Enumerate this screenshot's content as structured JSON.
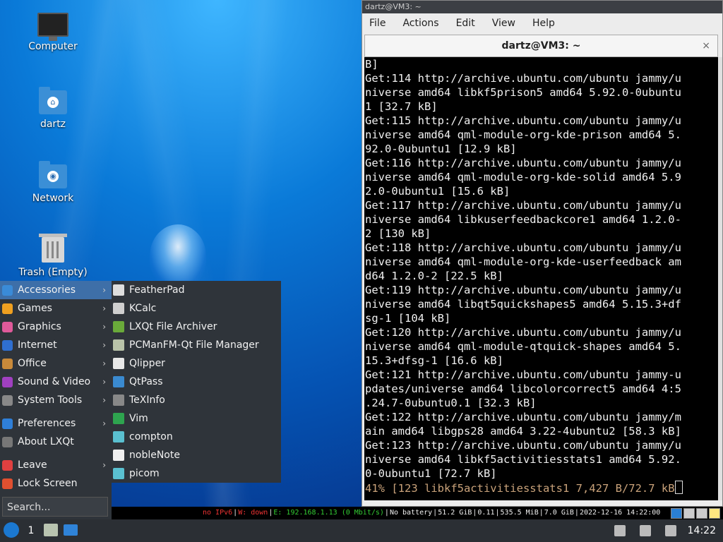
{
  "desktop": {
    "icons": [
      {
        "label": "Computer",
        "icon": "computer-icon"
      },
      {
        "label": "dartz",
        "icon": "home-folder-icon"
      },
      {
        "label": "Network",
        "icon": "network-folder-icon"
      },
      {
        "label": "Trash (Empty)",
        "icon": "trash-icon"
      }
    ]
  },
  "terminal": {
    "window_title": "dartz@VM3: ~",
    "menu": [
      "File",
      "Actions",
      "Edit",
      "View",
      "Help"
    ],
    "tab_title": "dartz@VM3: ~",
    "close_glyph": "×",
    "lines": [
      "B]",
      "Get:114 http://archive.ubuntu.com/ubuntu jammy/u",
      "niverse amd64 libkf5prison5 amd64 5.92.0-0ubuntu",
      "1 [32.7 kB]",
      "Get:115 http://archive.ubuntu.com/ubuntu jammy/u",
      "niverse amd64 qml-module-org-kde-prison amd64 5.",
      "92.0-0ubuntu1 [12.9 kB]",
      "Get:116 http://archive.ubuntu.com/ubuntu jammy/u",
      "niverse amd64 qml-module-org-kde-solid amd64 5.9",
      "2.0-0ubuntu1 [15.6 kB]",
      "Get:117 http://archive.ubuntu.com/ubuntu jammy/u",
      "niverse amd64 libkuserfeedbackcore1 amd64 1.2.0-",
      "2 [130 kB]",
      "Get:118 http://archive.ubuntu.com/ubuntu jammy/u",
      "niverse amd64 qml-module-org-kde-userfeedback am",
      "d64 1.2.0-2 [22.5 kB]",
      "Get:119 http://archive.ubuntu.com/ubuntu jammy/u",
      "niverse amd64 libqt5quickshapes5 amd64 5.15.3+df",
      "sg-1 [104 kB]",
      "Get:120 http://archive.ubuntu.com/ubuntu jammy/u",
      "niverse amd64 qml-module-qtquick-shapes amd64 5.",
      "15.3+dfsg-1 [16.6 kB]",
      "Get:121 http://archive.ubuntu.com/ubuntu jammy-u",
      "pdates/universe amd64 libcolorcorrect5 amd64 4:5",
      ".24.7-0ubuntu0.1 [32.3 kB]",
      "Get:122 http://archive.ubuntu.com/ubuntu jammy/m",
      "ain amd64 libgps28 amd64 3.22-4ubuntu2 [58.3 kB]",
      "Get:123 http://archive.ubuntu.com/ubuntu jammy/u",
      "niverse amd64 libkf5activitiesstats1 amd64 5.92.",
      "0-0ubuntu1 [72.7 kB]"
    ],
    "progress_line": "41% [123 libkf5activitiesstats1 7,427 B/72.7 kB"
  },
  "start_menu": {
    "categories": [
      {
        "label": "Accessories",
        "icon": "accessories-icon",
        "submenu": true,
        "active": true,
        "color": "#3a8bd8"
      },
      {
        "label": "Games",
        "icon": "games-icon",
        "submenu": true,
        "color": "#f0a020"
      },
      {
        "label": "Graphics",
        "icon": "graphics-icon",
        "submenu": true,
        "color": "#e05a9a"
      },
      {
        "label": "Internet",
        "icon": "internet-icon",
        "submenu": true,
        "color": "#2f6fd0"
      },
      {
        "label": "Office",
        "icon": "office-icon",
        "submenu": true,
        "color": "#c98a3a"
      },
      {
        "label": "Sound & Video",
        "icon": "sound-video-icon",
        "submenu": true,
        "color": "#a040c0"
      },
      {
        "label": "System Tools",
        "icon": "system-tools-icon",
        "submenu": true,
        "color": "#888888"
      }
    ],
    "settings": [
      {
        "label": "Preferences",
        "icon": "preferences-icon",
        "submenu": true,
        "color": "#2f7fd8"
      },
      {
        "label": "About LXQt",
        "icon": "about-icon",
        "submenu": false,
        "color": "#777777"
      }
    ],
    "session": [
      {
        "label": "Leave",
        "icon": "leave-icon",
        "submenu": true,
        "color": "#e04040"
      },
      {
        "label": "Lock Screen",
        "icon": "lock-icon",
        "submenu": false,
        "color": "#e05030"
      }
    ],
    "search_placeholder": "Search...",
    "arrow_glyph": "›"
  },
  "accessories_submenu": [
    {
      "label": "FeatherPad",
      "icon": "featherpad-icon",
      "color": "#dddddd"
    },
    {
      "label": "KCalc",
      "icon": "kcalc-icon",
      "color": "#cfcfcf"
    },
    {
      "label": "LXQt File Archiver",
      "icon": "archiver-icon",
      "color": "#6aaa3a"
    },
    {
      "label": "PCManFM-Qt File Manager",
      "icon": "file-manager-icon",
      "color": "#b8c2a8"
    },
    {
      "label": "Qlipper",
      "icon": "clipboard-icon",
      "color": "#e8e8e8"
    },
    {
      "label": "QtPass",
      "icon": "qtpass-icon",
      "color": "#3a8ad0"
    },
    {
      "label": "TeXInfo",
      "icon": "info-icon",
      "color": "#888888"
    },
    {
      "label": "Vim",
      "icon": "vim-icon",
      "color": "#2ea44f"
    },
    {
      "label": "compton",
      "icon": "compton-icon",
      "color": "#5ac0d0"
    },
    {
      "label": "nobleNote",
      "icon": "notebook-icon",
      "color": "#f0f0f0"
    },
    {
      "label": "picom",
      "icon": "picom-icon",
      "color": "#5ac0d0"
    }
  ],
  "status_bar": {
    "ipv6": "no IPv6",
    "wifi": "W: down",
    "ethernet": "E: 192.168.1.13 (0 Mbit/s)",
    "battery": "No battery",
    "disk": "51.2 GiB",
    "load": "0.11",
    "memory": "535.5 MiB",
    "disk2": "7.0 GiB",
    "datetime": "2022-12-16 14:22:00"
  },
  "taskbar": {
    "workspace": "1",
    "clock": "14:22"
  }
}
